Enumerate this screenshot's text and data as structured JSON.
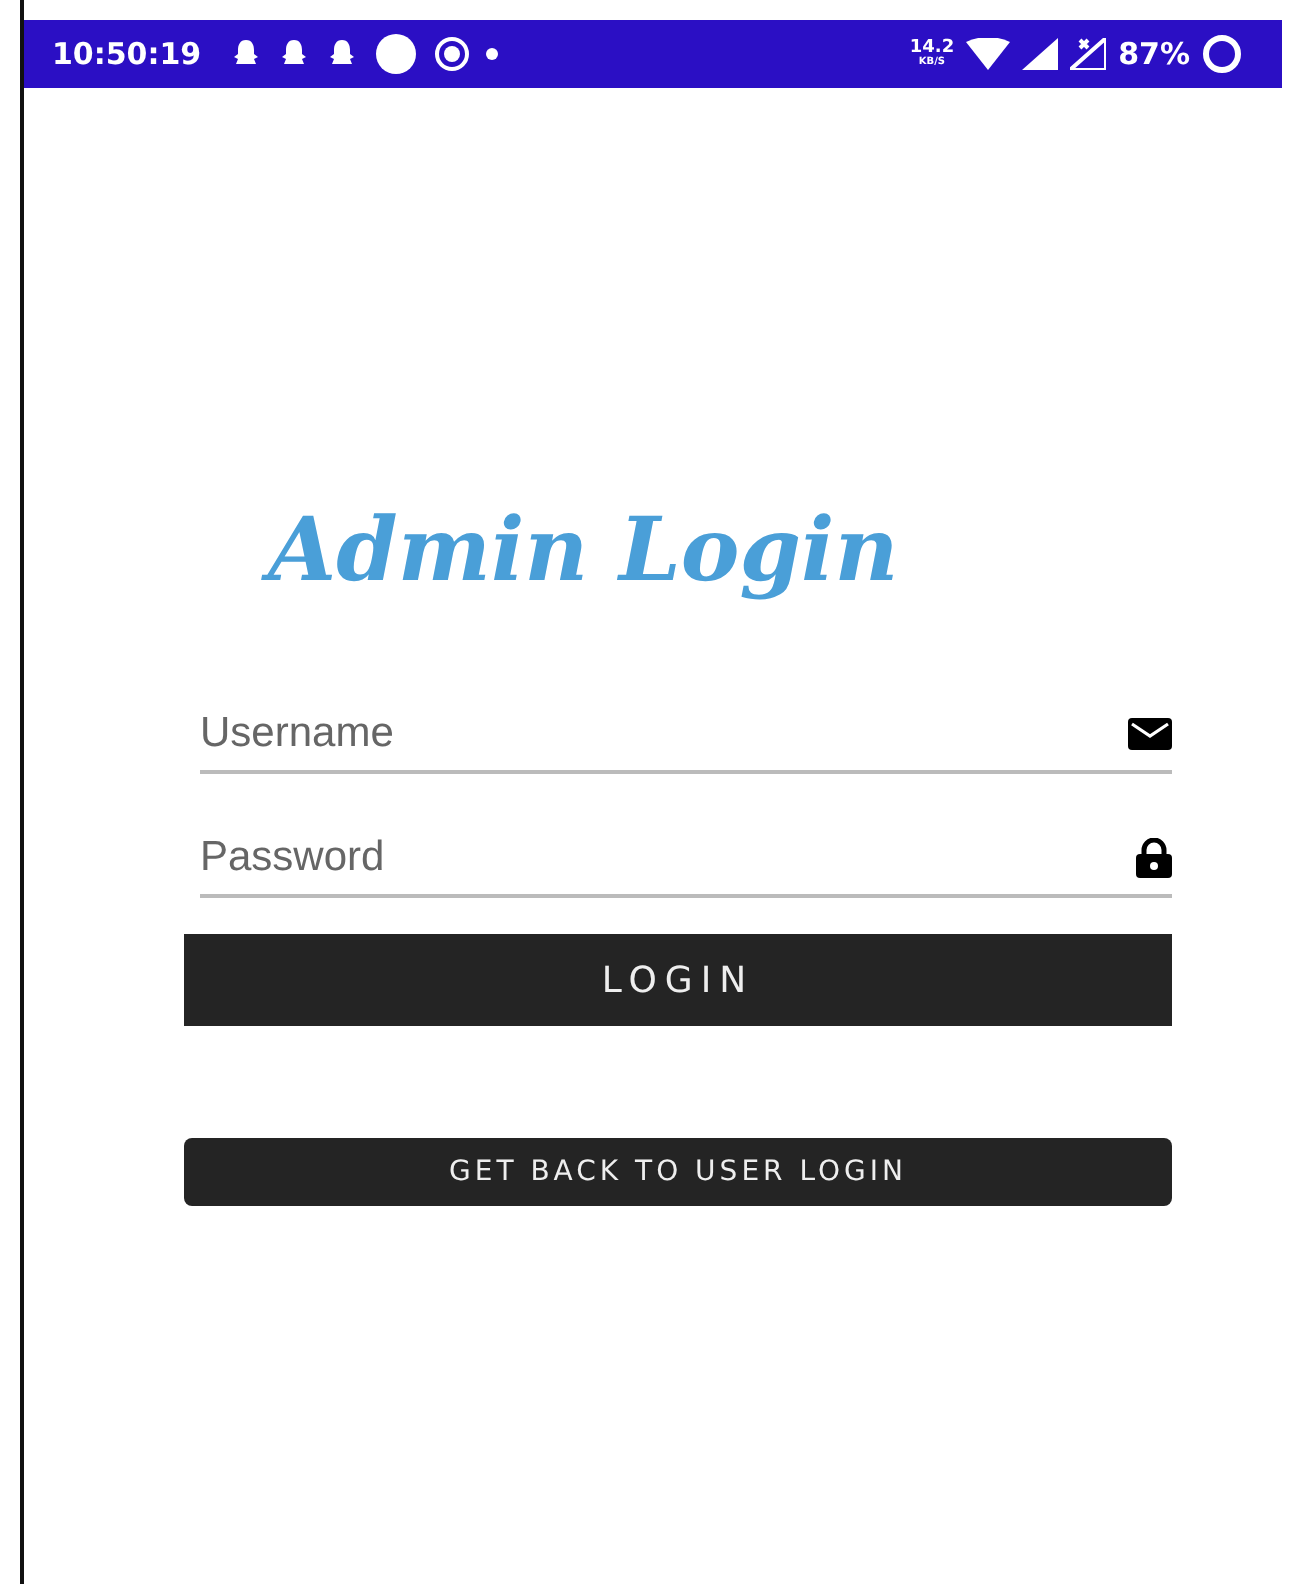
{
  "status_bar": {
    "time": "10:50:19",
    "speed_value": "14.2",
    "speed_unit": "KB/S",
    "battery": "87%"
  },
  "title": "Admin Login",
  "fields": [
    {
      "placeholder": "Username",
      "kind": "email"
    },
    {
      "placeholder": "Password",
      "kind": "password"
    }
  ],
  "login_button": "LOGIN",
  "back_button": "GET BACK TO USER LOGIN"
}
